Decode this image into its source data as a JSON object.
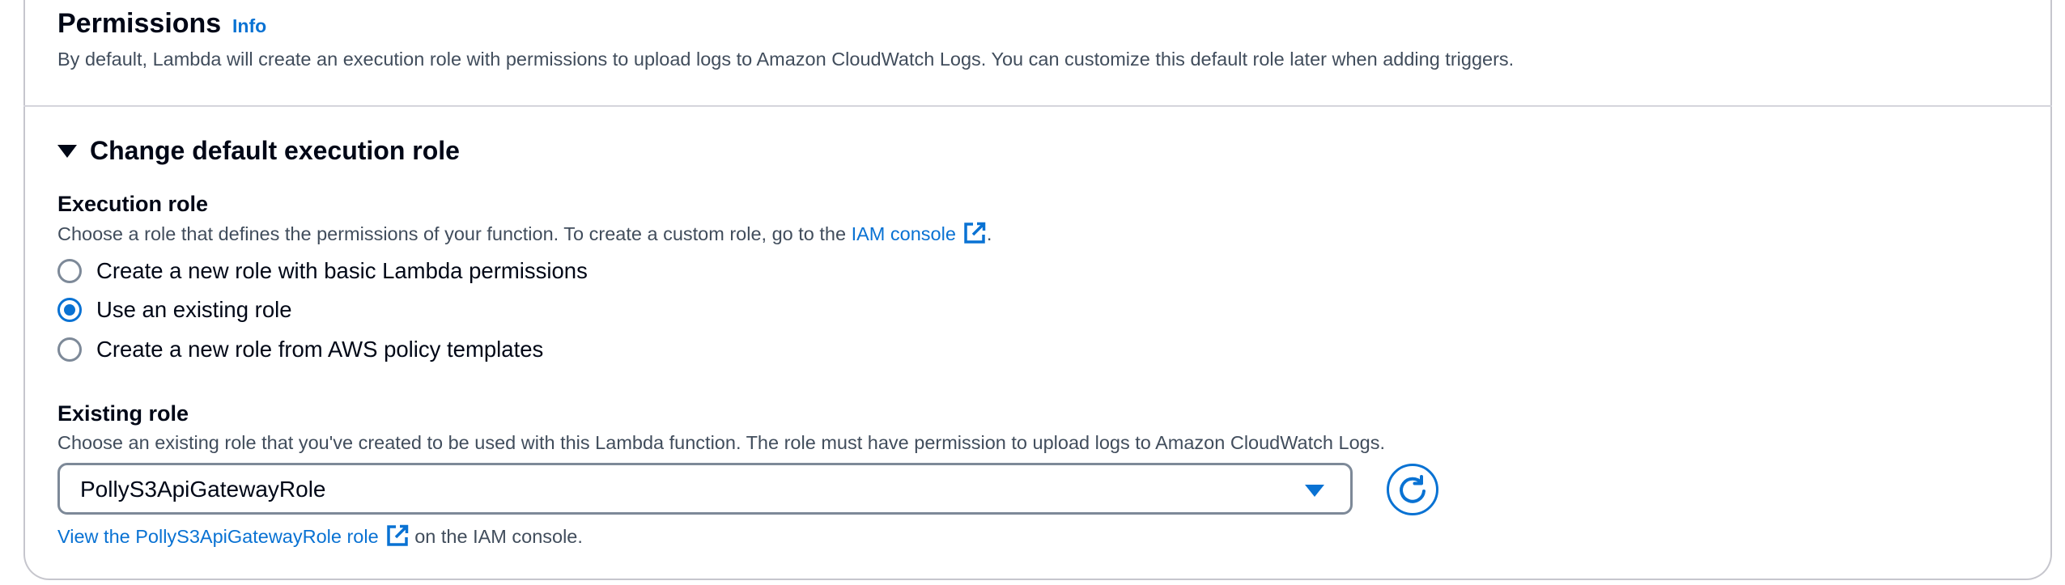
{
  "permissions": {
    "title": "Permissions",
    "info_label": "Info",
    "description": "By default, Lambda will create an execution role with permissions to upload logs to Amazon CloudWatch Logs. You can customize this default role later when adding triggers."
  },
  "execution_role_section": {
    "expander_label": "Change default execution role",
    "expanded": true,
    "label": "Execution role",
    "description_prefix": "Choose a role that defines the permissions of your function. To create a custom role, go to the ",
    "iam_console_link": "IAM console",
    "description_suffix": ".",
    "options": [
      {
        "label": "Create a new role with basic Lambda permissions",
        "selected": false
      },
      {
        "label": "Use an existing role",
        "selected": true
      },
      {
        "label": "Create a new role from AWS policy templates",
        "selected": false
      }
    ]
  },
  "existing_role": {
    "label": "Existing role",
    "description": "Choose an existing role that you've created to be used with this Lambda function. The role must have permission to upload logs to Amazon CloudWatch Logs.",
    "selected_value": "PollyS3ApiGatewayRole",
    "view_link": "View the PollyS3ApiGatewayRole role",
    "view_suffix": " on the IAM console."
  },
  "icons": {
    "external": "external-link-icon",
    "refresh": "refresh-icon",
    "caret": "caret-down-icon",
    "dropdown": "dropdown-arrow-icon"
  },
  "colors": {
    "link": "#0972d3",
    "text": "#000716",
    "secondary_text": "#414d5c",
    "border": "#7d8998"
  }
}
